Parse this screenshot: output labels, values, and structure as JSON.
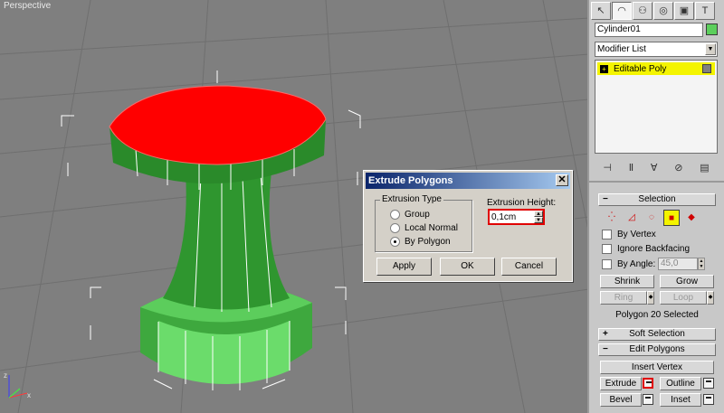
{
  "viewport": {
    "label": "Perspective"
  },
  "dialog": {
    "title": "Extrude Polygons",
    "extrusion_type_label": "Extrusion Type",
    "options": [
      "Group",
      "Local Normal",
      "By Polygon"
    ],
    "selected_option": "By Polygon",
    "extrusion_height_label": "Extrusion Height:",
    "extrusion_height_value": "0,1cm",
    "buttons": {
      "apply": "Apply",
      "ok": "OK",
      "cancel": "Cancel"
    },
    "close_glyph": "✕"
  },
  "panel": {
    "tabs": [
      "create-icon",
      "modify-icon",
      "hierarchy-icon",
      "motion-icon",
      "display-icon",
      "utilities-icon"
    ],
    "object_name": "Cylinder01",
    "object_color": "#5ccf5c",
    "modifier_list": "Modifier List",
    "stack_item": "Editable Poly",
    "selection": {
      "title": "Selection",
      "by_vertex": "By Vertex",
      "ignore_backfacing": "Ignore Backfacing",
      "by_angle": "By Angle:",
      "angle_value": "45,0",
      "shrink": "Shrink",
      "grow": "Grow",
      "ring": "Ring",
      "loop": "Loop",
      "status": "Polygon 20 Selected"
    },
    "soft_selection": {
      "title": "Soft Selection"
    },
    "edit_polygons": {
      "title": "Edit Polygons",
      "insert_vertex": "Insert Vertex",
      "extrude": "Extrude",
      "outline": "Outline",
      "bevel": "Bevel",
      "inset": "Inset"
    }
  },
  "colors": {
    "viewport_bg": "#7f7f7f",
    "selected_face": "#ff0000",
    "mesh": "#3ea83e",
    "stack_highlight": "#f4f400",
    "highlight_border": "#e00000"
  }
}
